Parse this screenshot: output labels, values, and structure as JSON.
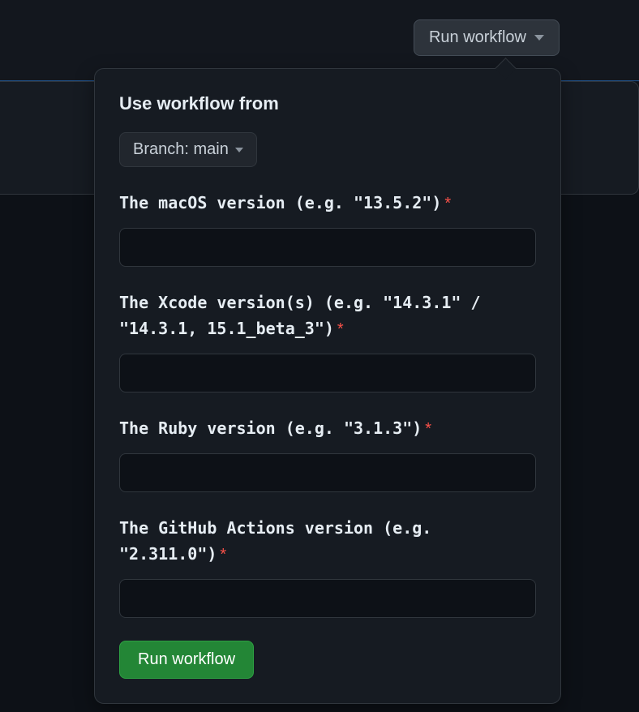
{
  "header": {
    "run_workflow_label": "Run workflow"
  },
  "popup": {
    "title": "Use workflow from",
    "branch_prefix": "Branch:",
    "branch_name": "main",
    "required_mark": "*",
    "fields": [
      {
        "label": "The macOS version (e.g. \"13.5.2\")",
        "value": ""
      },
      {
        "label": "The Xcode version(s) (e.g. \"14.3.1\" / \"14.3.1, 15.1_beta_3\")",
        "value": ""
      },
      {
        "label": "The Ruby version (e.g. \"3.1.3\")",
        "value": ""
      },
      {
        "label": "The GitHub Actions version (e.g. \"2.311.0\")",
        "value": ""
      }
    ],
    "submit_label": "Run workflow"
  }
}
